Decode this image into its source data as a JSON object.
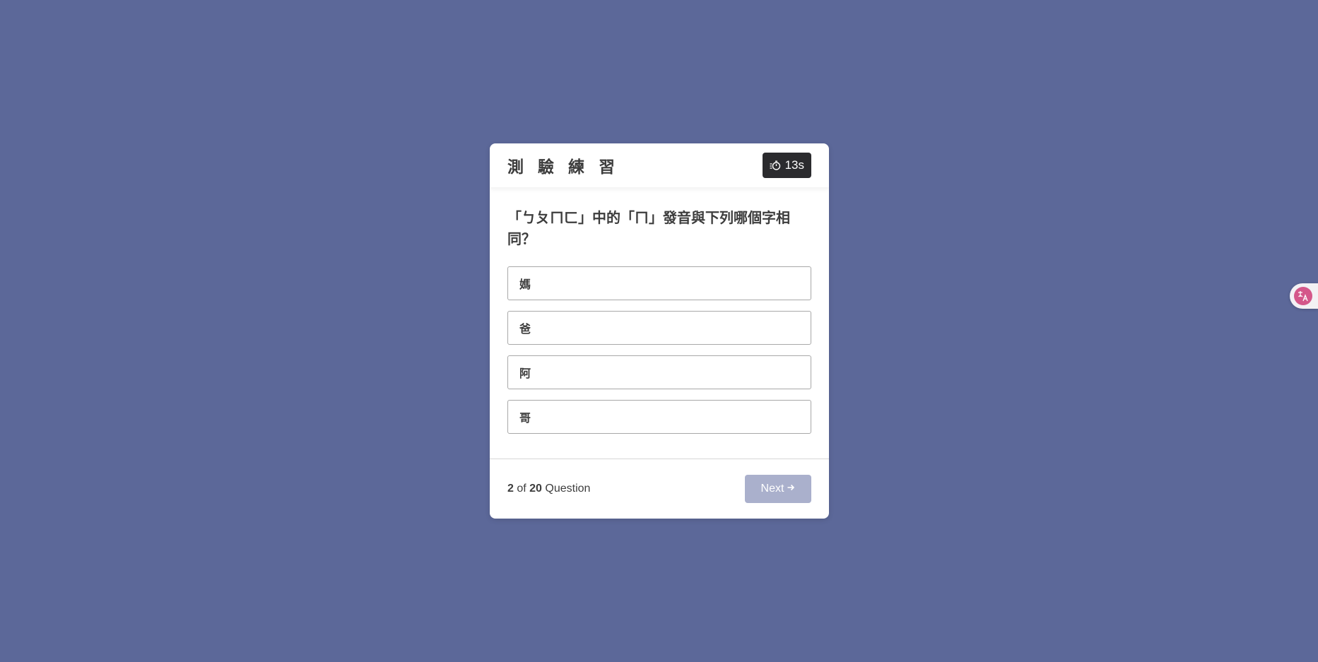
{
  "quiz": {
    "title": "測 驗 練 習",
    "timer": "13s",
    "question": "「ㄅㄆㄇㄈ」中的「ㄇ」發音與下列哪個字相同？",
    "options": [
      "媽",
      "爸",
      "阿",
      "哥"
    ],
    "progress": {
      "current": "2",
      "of": "of",
      "total": "20",
      "suffix": "Question"
    },
    "next_label": "Next"
  },
  "colors": {
    "background": "#5c6899",
    "timer_bg": "#2b2b2e",
    "next_button_disabled": "#aab0cc"
  },
  "icons": {
    "timer": "stopwatch-icon",
    "next": "arrow-right-icon",
    "translate": "translate-icon"
  }
}
